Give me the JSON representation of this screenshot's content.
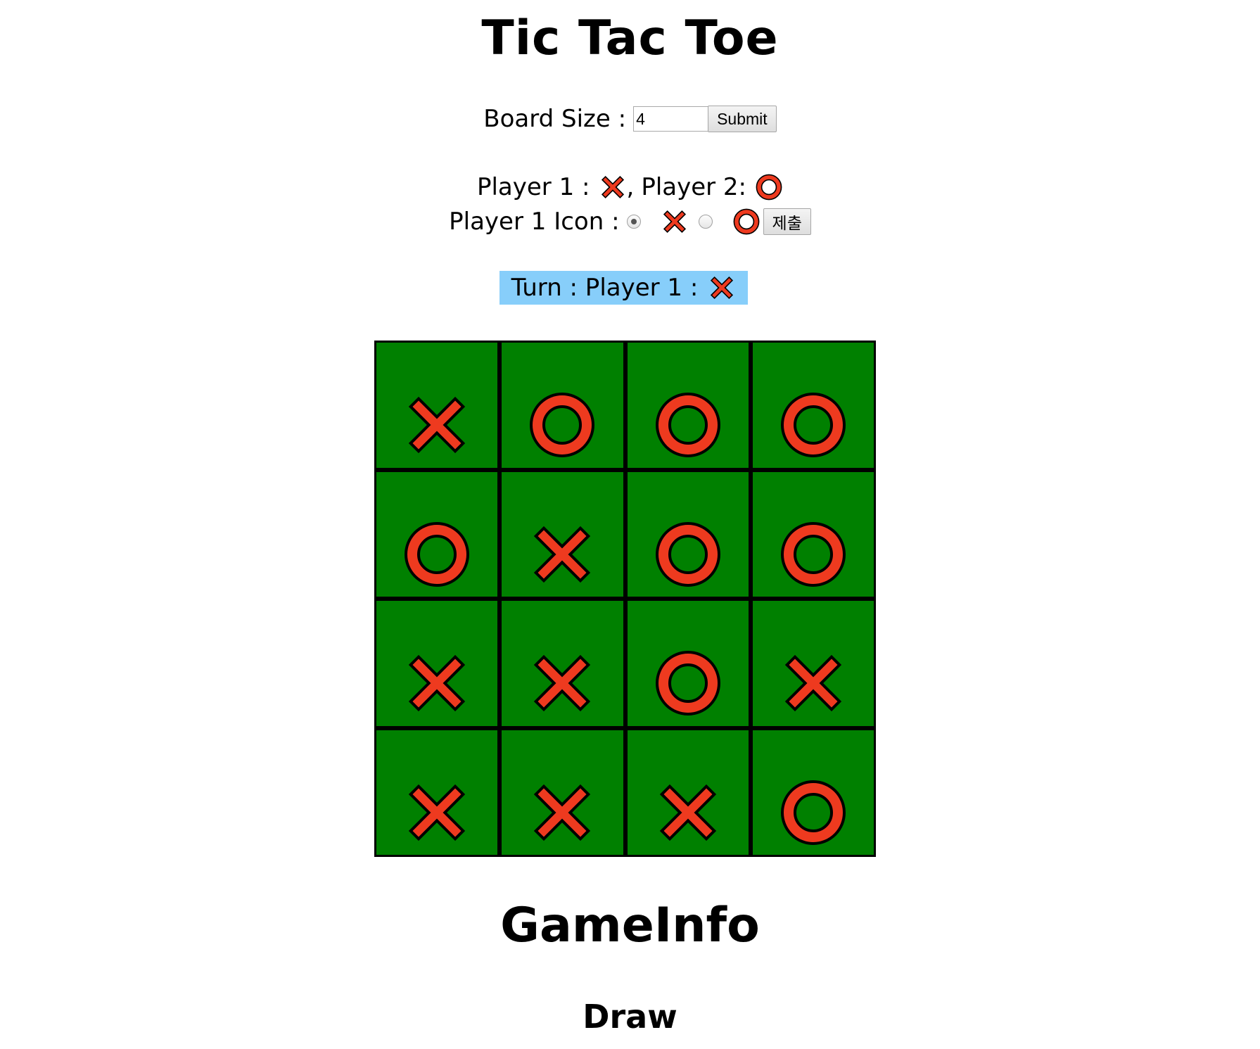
{
  "title": "Tic Tac Toe",
  "board_size": {
    "label": "Board Size :",
    "value": "4",
    "submit_label": "Submit"
  },
  "players": {
    "p1_label": "Player 1 :",
    "sep": ",",
    "p2_label": "Player 2:",
    "p1_icon": "x",
    "p2_icon": "o"
  },
  "icon_select": {
    "label": "Player 1 Icon :",
    "options": [
      "x",
      "o"
    ],
    "selected": "x",
    "submit_label": "제출"
  },
  "turn": {
    "label": "Turn : Player 1 :",
    "icon": "x",
    "highlight_color": "#87cefa"
  },
  "board": {
    "size": 4,
    "cell_color": "#008000",
    "mark_color": "#ee3a1f",
    "cells": [
      [
        "x",
        "o",
        "o",
        "o"
      ],
      [
        "o",
        "x",
        "o",
        "o"
      ],
      [
        "x",
        "x",
        "o",
        "x"
      ],
      [
        "x",
        "x",
        "x",
        "o"
      ]
    ]
  },
  "game_info": {
    "title": "GameInfo",
    "result": "Draw"
  }
}
